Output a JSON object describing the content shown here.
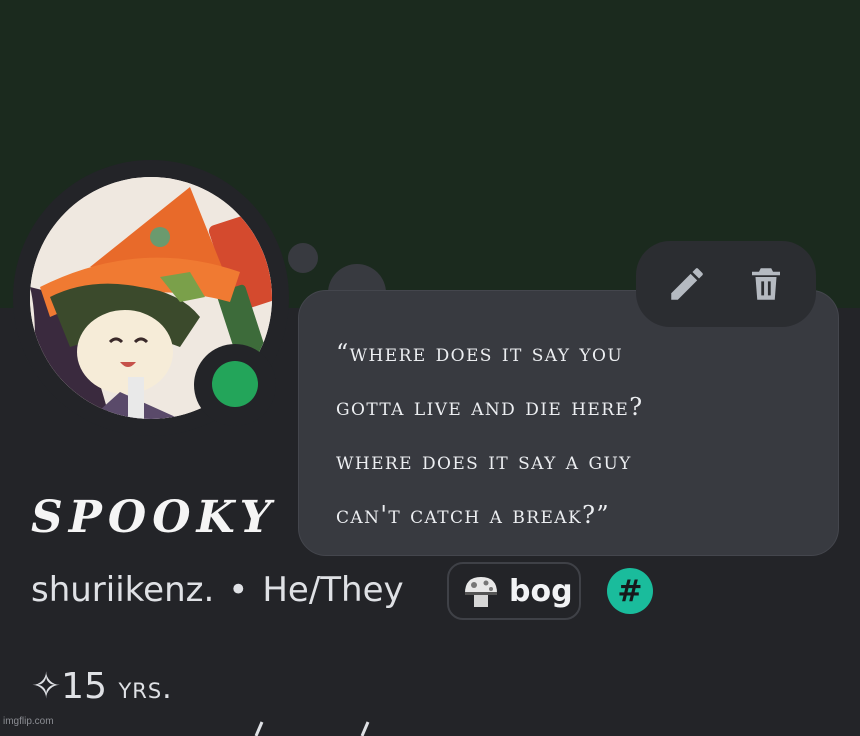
{
  "profile": {
    "display_name": "SPOOKY",
    "username": "shuriikenz.",
    "separator": "•",
    "pronouns": "He/They",
    "status_online_color": "#23a55a"
  },
  "custom_status": {
    "lines": [
      "“where does it say you",
      "gotta live and die here?",
      "where does it say a guy",
      "can't catch a break?”"
    ],
    "actions": [
      {
        "icon": "pencil-icon",
        "label": "Edit"
      },
      {
        "icon": "trash-icon",
        "label": "Delete"
      }
    ]
  },
  "badges": {
    "tag_icon": "mushroom-icon",
    "tag_label": "bog",
    "hash_icon": "hashtag-icon",
    "hash_symbol": "#",
    "hash_color": "#1abc9c"
  },
  "bio": {
    "sparkle": "✧",
    "age_value": "15",
    "age_unit": "yrs."
  },
  "watermark": "imgflip.com",
  "colors": {
    "banner": "#1b2a1e",
    "background": "#232428",
    "bubble": "#383a40"
  }
}
